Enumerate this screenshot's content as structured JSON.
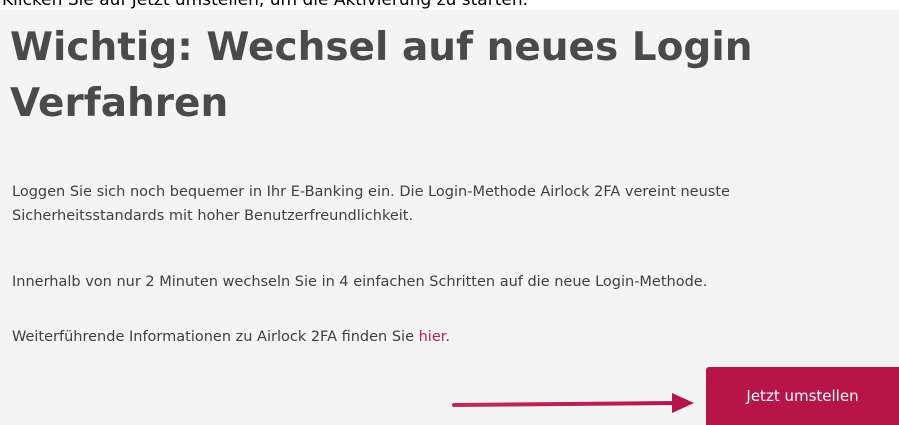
{
  "instruction": "Klicken Sie auf Jetzt umstellen, um die Aktivierung zu starten.",
  "title": "Wichtig: Wechsel auf neues Login Verfahren",
  "paragraph1": "Loggen Sie sich noch bequemer in Ihr E-Banking ein. Die Login-Methode Airlock 2FA vereint neuste Sicherheitsstandards mit hoher Benutzerfreundlichkeit.",
  "paragraph2": "Innerhalb von nur 2 Minuten wechseln Sie in 4 einfachen Schritten auf die neue Login-Methode.",
  "paragraph3_prefix": "Weiterführende Informationen zu Airlock 2FA finden Sie ",
  "paragraph3_link": "hier",
  "paragraph3_suffix": ".",
  "cta_label": "Jetzt umstellen",
  "colors": {
    "accent": "#b7154a",
    "link": "#c0204a",
    "panel_bg": "#f4f4f4",
    "title": "#4a4a4a"
  },
  "icons": {
    "arrow": "right-arrow-icon"
  }
}
